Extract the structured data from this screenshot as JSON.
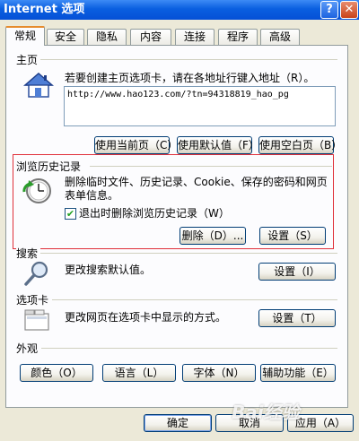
{
  "window": {
    "title": "Internet 选项",
    "help_glyph": "?",
    "close_glyph": "✕"
  },
  "tabs": [
    {
      "label": "常规",
      "active": true
    },
    {
      "label": "安全"
    },
    {
      "label": "隐私"
    },
    {
      "label": "内容"
    },
    {
      "label": "连接"
    },
    {
      "label": "程序"
    },
    {
      "label": "高级"
    }
  ],
  "homepage": {
    "group_label": "主页",
    "description": "若要创建主页选项卡，请在各地址行键入地址（R）。",
    "url_value": "http://www.hao123.com/?tn=94318819_hao_pg",
    "use_current": "使用当前页（C）",
    "use_default": "使用默认值（F）",
    "use_blank": "使用空白页（B）",
    "icon": "house-icon"
  },
  "history": {
    "group_label": "浏览历史记录",
    "description": "删除临时文件、历史记录、Cookie、保存的密码和网页表单信息。",
    "delete_on_exit_label": "退出时删除浏览历史记录（W）",
    "delete_on_exit_checked": true,
    "delete_button": "删除（D）...",
    "settings_button": "设置（S）",
    "icon": "history-clock-icon",
    "highlight_color": "#e0303a"
  },
  "search": {
    "group_label": "搜索",
    "description": "更改搜索默认值。",
    "settings_button": "设置（I）",
    "icon": "magnifier-icon"
  },
  "tabsgroup": {
    "group_label": "选项卡",
    "description": "更改网页在选项卡中显示的方式。",
    "settings_button": "设置（T）",
    "icon": "tabbed-window-icon"
  },
  "appearance": {
    "group_label": "外观",
    "colors_button": "颜色（O）",
    "languages_button": "语言（L）",
    "fonts_button": "字体（N）",
    "accessibility_button": "辅助功能（E）"
  },
  "footer": {
    "ok_button": "确定",
    "cancel_button": "取消",
    "apply_button": "应用（A）"
  },
  "watermark": "Bai经验"
}
